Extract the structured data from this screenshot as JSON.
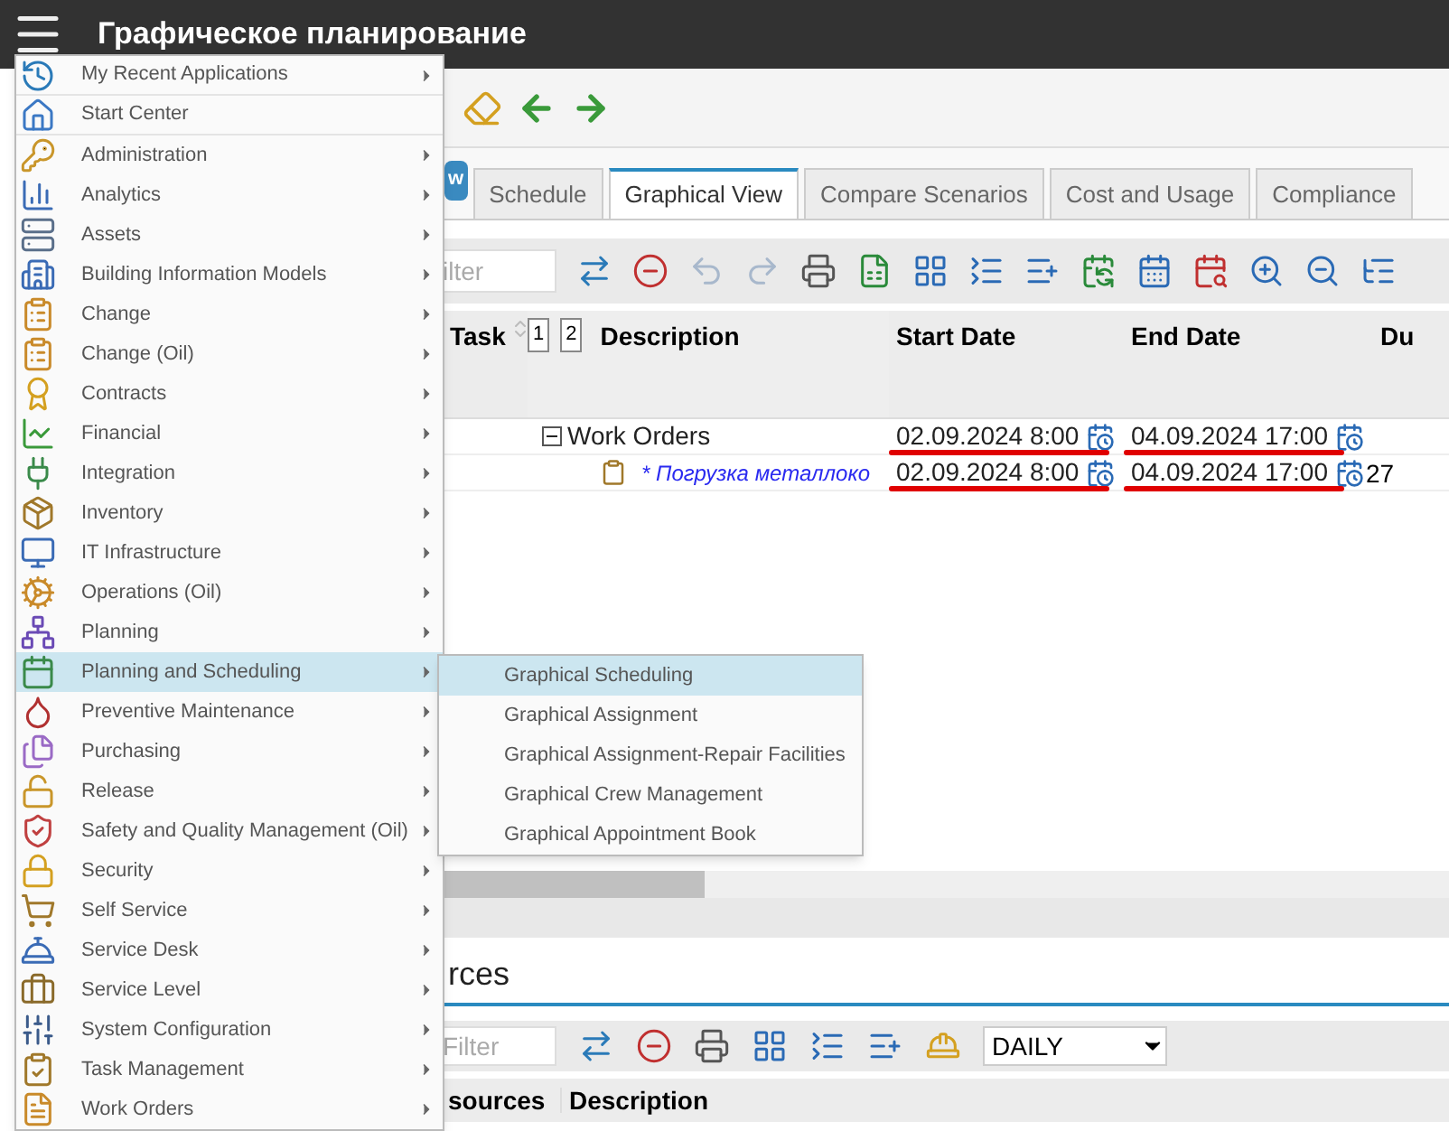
{
  "header": {
    "title": "Графическое планирование"
  },
  "tabs": [
    {
      "label": "w",
      "selected": false,
      "kind": "button"
    },
    {
      "label": "Schedule",
      "selected": false,
      "kind": "tab"
    },
    {
      "label": "Graphical View",
      "selected": true,
      "kind": "tab"
    },
    {
      "label": "Compare Scenarios",
      "selected": false,
      "kind": "tab"
    },
    {
      "label": "Cost and Usage",
      "selected": false,
      "kind": "tab"
    },
    {
      "label": "Compliance",
      "selected": false,
      "kind": "tab"
    }
  ],
  "task_filter": {
    "placeholder": "ilter"
  },
  "task_table": {
    "columns": [
      "Task",
      "1",
      "2",
      "Description",
      "Start Date",
      "End Date",
      "Du"
    ],
    "rows": [
      {
        "kind": "group",
        "description": "Work Orders",
        "start": "02.09.2024 8:00",
        "end": "04.09.2024 17:00",
        "duration": "",
        "underlined": true
      },
      {
        "kind": "task",
        "description": "* Погрузка металлоко",
        "start": "02.09.2024 8:00",
        "end": "04.09.2024 17:00",
        "duration": "27",
        "underlined": true
      }
    ]
  },
  "resources": {
    "title": "rces",
    "filter_placeholder": "Filter",
    "period": "DAILY",
    "columns": [
      "sources",
      "Description"
    ]
  },
  "menu": {
    "items": [
      {
        "label": "My Recent Applications",
        "submenu": true,
        "selected": false
      },
      {
        "label": "Start Center",
        "submenu": false,
        "selected": false
      },
      {
        "label": "Administration",
        "submenu": true,
        "selected": false
      },
      {
        "label": "Analytics",
        "submenu": true,
        "selected": false
      },
      {
        "label": "Assets",
        "submenu": true,
        "selected": false
      },
      {
        "label": "Building Information Models",
        "submenu": true,
        "selected": false
      },
      {
        "label": "Change",
        "submenu": true,
        "selected": false
      },
      {
        "label": "Change (Oil)",
        "submenu": true,
        "selected": false
      },
      {
        "label": "Contracts",
        "submenu": true,
        "selected": false
      },
      {
        "label": "Financial",
        "submenu": true,
        "selected": false
      },
      {
        "label": "Integration",
        "submenu": true,
        "selected": false
      },
      {
        "label": "Inventory",
        "submenu": true,
        "selected": false
      },
      {
        "label": "IT Infrastructure",
        "submenu": true,
        "selected": false
      },
      {
        "label": "Operations (Oil)",
        "submenu": true,
        "selected": false
      },
      {
        "label": "Planning",
        "submenu": true,
        "selected": false
      },
      {
        "label": "Planning and Scheduling",
        "submenu": true,
        "selected": true
      },
      {
        "label": "Preventive Maintenance",
        "submenu": true,
        "selected": false
      },
      {
        "label": "Purchasing",
        "submenu": true,
        "selected": false
      },
      {
        "label": "Release",
        "submenu": true,
        "selected": false
      },
      {
        "label": "Safety and Quality Management (Oil)",
        "submenu": true,
        "selected": false
      },
      {
        "label": "Security",
        "submenu": true,
        "selected": false
      },
      {
        "label": "Self Service",
        "submenu": true,
        "selected": false
      },
      {
        "label": "Service Desk",
        "submenu": true,
        "selected": false
      },
      {
        "label": "Service Level",
        "submenu": true,
        "selected": false
      },
      {
        "label": "System Configuration",
        "submenu": true,
        "selected": false
      },
      {
        "label": "Task Management",
        "submenu": true,
        "selected": false
      },
      {
        "label": "Work Orders",
        "submenu": true,
        "selected": false
      }
    ]
  },
  "submenu": {
    "items": [
      {
        "label": "Graphical Scheduling",
        "selected": true
      },
      {
        "label": "Graphical Assignment",
        "selected": false
      },
      {
        "label": "Graphical Assignment-Repair Facilities",
        "selected": false
      },
      {
        "label": "Graphical Crew Management",
        "selected": false
      },
      {
        "label": "Graphical Appointment Book",
        "selected": false
      }
    ]
  }
}
